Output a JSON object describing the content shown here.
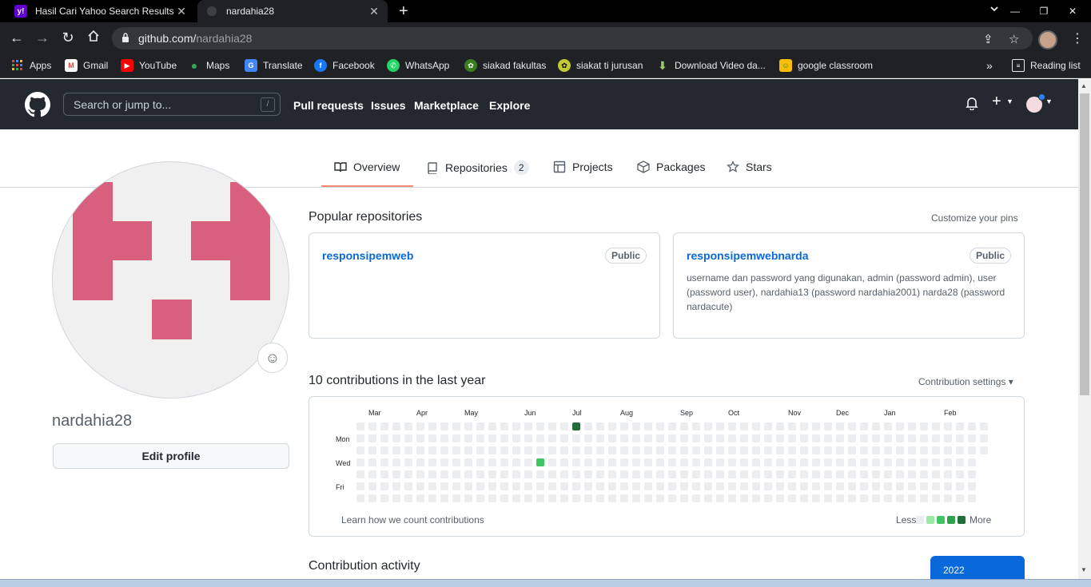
{
  "browser": {
    "tabs": [
      {
        "title": "Hasil Cari Yahoo Search Results Y",
        "favicon": "yahoo-icon",
        "color": "#6001d2"
      },
      {
        "title": "nardahia28",
        "favicon": "github-icon"
      }
    ],
    "url_host": "github.com/",
    "url_path": "nardahia28",
    "bookmarks": [
      {
        "label": "Apps",
        "icon": "apps-grid-icon"
      },
      {
        "label": "Gmail",
        "icon": "gmail-icon"
      },
      {
        "label": "YouTube",
        "icon": "youtube-icon"
      },
      {
        "label": "Maps",
        "icon": "maps-icon"
      },
      {
        "label": "Translate",
        "icon": "translate-icon"
      },
      {
        "label": "Facebook",
        "icon": "facebook-icon"
      },
      {
        "label": "WhatsApp",
        "icon": "whatsapp-icon"
      },
      {
        "label": "siakad fakultas",
        "icon": "campus-icon"
      },
      {
        "label": "siakat ti jurusan",
        "icon": "campus-icon"
      },
      {
        "label": "Download Video da...",
        "icon": "download-icon"
      },
      {
        "label": "google classroom",
        "icon": "classroom-icon"
      }
    ],
    "more_bookmarks": "»",
    "reading_list": "Reading list"
  },
  "github": {
    "search_placeholder": "Search or jump to...",
    "search_shortcut": "/",
    "nav": [
      "Pull requests",
      "Issues",
      "Marketplace",
      "Explore"
    ],
    "plus": "+",
    "profile_tabs": [
      {
        "label": "Overview",
        "icon": "book-icon",
        "active": true
      },
      {
        "label": "Repositories",
        "icon": "repo-icon",
        "count": "2"
      },
      {
        "label": "Projects",
        "icon": "table-icon"
      },
      {
        "label": "Packages",
        "icon": "package-icon"
      },
      {
        "label": "Stars",
        "icon": "star-icon"
      }
    ],
    "username": "nardahia28",
    "edit_profile": "Edit profile",
    "popular_title": "Popular repositories",
    "customize_pins": "Customize your pins",
    "repos": [
      {
        "name": "responsipemweb",
        "visibility": "Public",
        "description": ""
      },
      {
        "name": "responsipemwebnarda",
        "visibility": "Public",
        "description": "username dan password yang digunakan, admin (password admin), user (password user), nardahia13 (password nardahia2001) narda28 (password nardacute)"
      }
    ],
    "contrib_title": "10 contributions in the last year",
    "contrib_settings": "Contribution settings ▾",
    "months": [
      "Mar",
      "Apr",
      "May",
      "Jun",
      "Jul",
      "Aug",
      "Sep",
      "Oct",
      "Nov",
      "Dec",
      "Jan",
      "Feb"
    ],
    "days": [
      "Mon",
      "Wed",
      "Fri"
    ],
    "learn_link": "Learn how we count contributions",
    "less": "Less",
    "more": "More",
    "legend_colors": [
      "#ebedf0",
      "#9be9a8",
      "#40c463",
      "#30a14e",
      "#216e39"
    ],
    "activity_title": "Contribution activity",
    "year": "2022"
  }
}
